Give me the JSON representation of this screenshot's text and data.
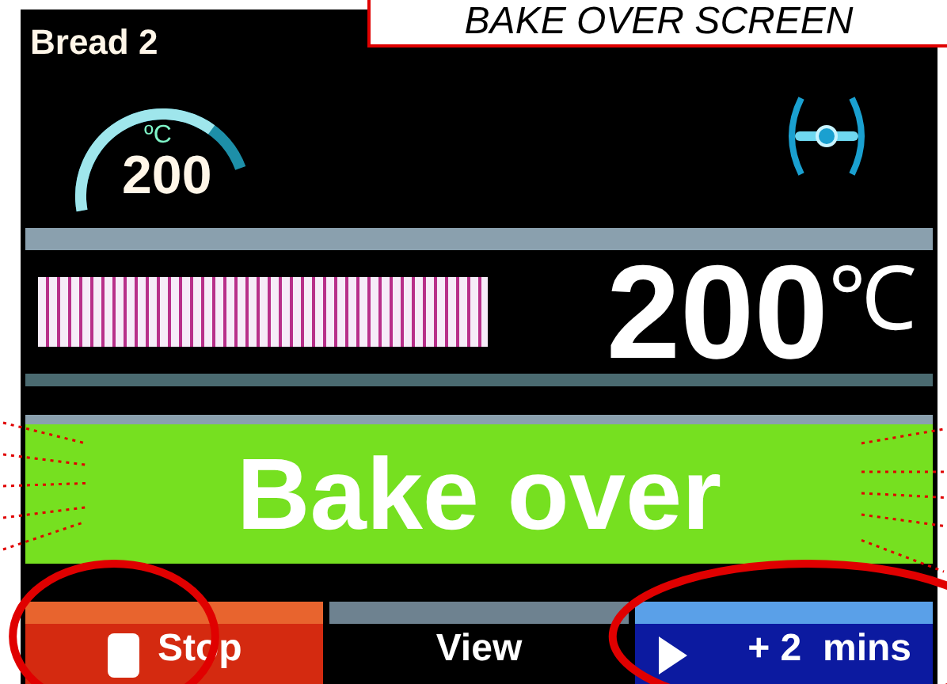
{
  "caption": "BAKE OVER SCREEN",
  "program": "Bread 2",
  "gauge": {
    "unit": "ºC",
    "value": "200",
    "level": 0.8
  },
  "temperature": {
    "value": "200",
    "unit": "℃"
  },
  "banner": "Bake over",
  "buttons": [
    {
      "kind": "stop",
      "label": "Stop",
      "circled": true
    },
    {
      "kind": "view",
      "label": "View",
      "circled": false
    },
    {
      "kind": "extend",
      "label": "+ 2  mins",
      "circled": true
    }
  ]
}
